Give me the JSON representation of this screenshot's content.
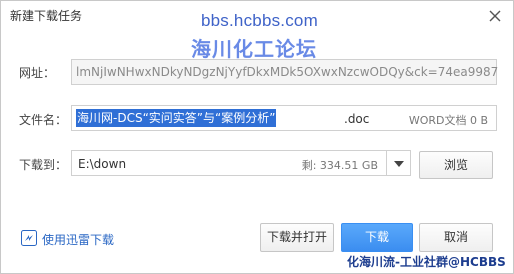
{
  "window": {
    "title": "新建下载任务",
    "close_icon": "close-icon"
  },
  "watermark": {
    "url": "bbs.hcbbs.com",
    "name": "海川化工论坛",
    "bottom": "化海川流-工业社群@HCBBS"
  },
  "url_row": {
    "label": "网址：",
    "value": "lmNjIwNHwxNDkyNDgzNjYyfDkxMDk5OXwxNzcwODQy&ck=74ea9987"
  },
  "filename_row": {
    "label": "文件名：",
    "selected_text": "海川网-DCS“实问实答”与“案例分析”",
    "extension": ".doc",
    "file_info": "WORD文档 0 B"
  },
  "download_row": {
    "label": "下载到：",
    "path": "E:\\down",
    "free_space": "剩: 334.51 GB",
    "dropdown_icon": "chevron-down-icon"
  },
  "buttons": {
    "browse": "浏览",
    "download_and_open": "下载并打开",
    "download": "下载",
    "cancel": "取消"
  },
  "thunder": {
    "label": "使用迅雷下载",
    "icon": "thunder-icon"
  },
  "colors": {
    "selection": "#2f6fd6",
    "primary_button": "#3b8df0",
    "link": "#2a67c4",
    "watermark": "#3f63c8"
  }
}
